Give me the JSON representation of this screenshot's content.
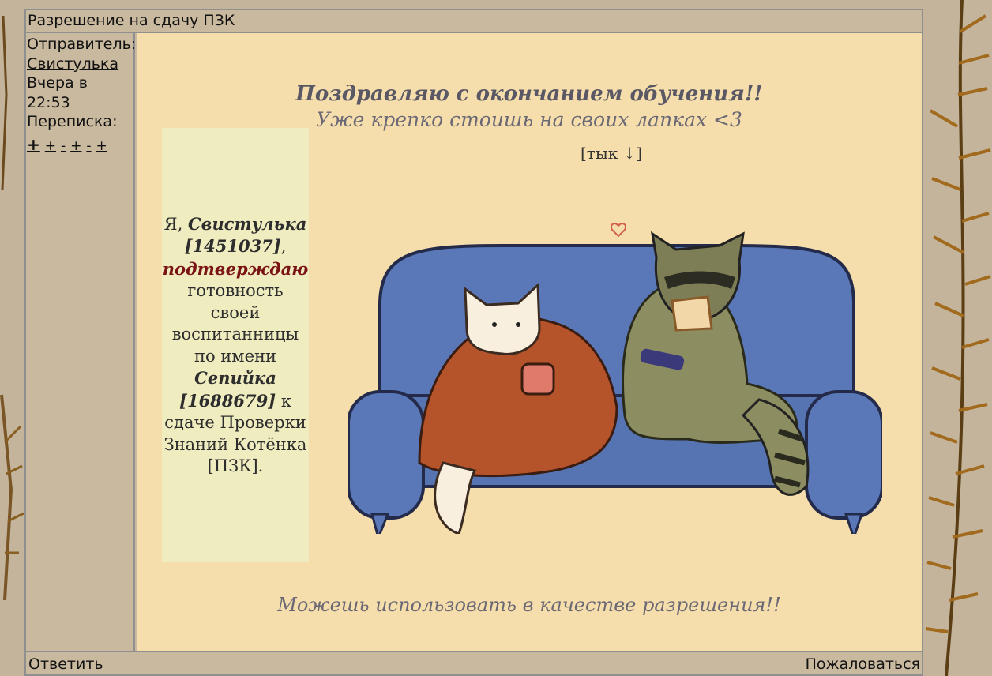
{
  "message": {
    "subject": "Разрешение на сдачу ПЗК",
    "sender_label": "Отправитель:",
    "sender_name": "Свистулька",
    "date_line1": "Вчера в",
    "date_line2": "22:53",
    "thread_label": "Переписка:",
    "thread_nav": [
      "+",
      "+",
      "-",
      "+",
      "-",
      "+"
    ]
  },
  "content": {
    "heading": "Поздравляю с окончанием обучения!!",
    "subheading": "Уже крепко стоишь на своих лапках <3",
    "poke_link": "[тык ↓]",
    "confirm": {
      "prefix": "Я, ",
      "sender_name": "Свистулька [1451037]",
      "comma": ",",
      "verb": "подтверждаю",
      "middle": " готовность своей воспитанницы по имени ",
      "student_name": "Сепийка [1688679]",
      "suffix": " к сдаче Проверки Знаний Котёнка [ПЗК]."
    },
    "footer_note": "Можешь использовать в качестве разрешения!!"
  },
  "actions": {
    "reply": "Ответить",
    "report": "Пожаловаться"
  },
  "colors": {
    "content_bg": "#f5deab",
    "confirm_box_bg": "#efecc0",
    "confirm_verb": "#7a1313",
    "heading": "#5b5866",
    "sofa": "#5a78b8"
  }
}
